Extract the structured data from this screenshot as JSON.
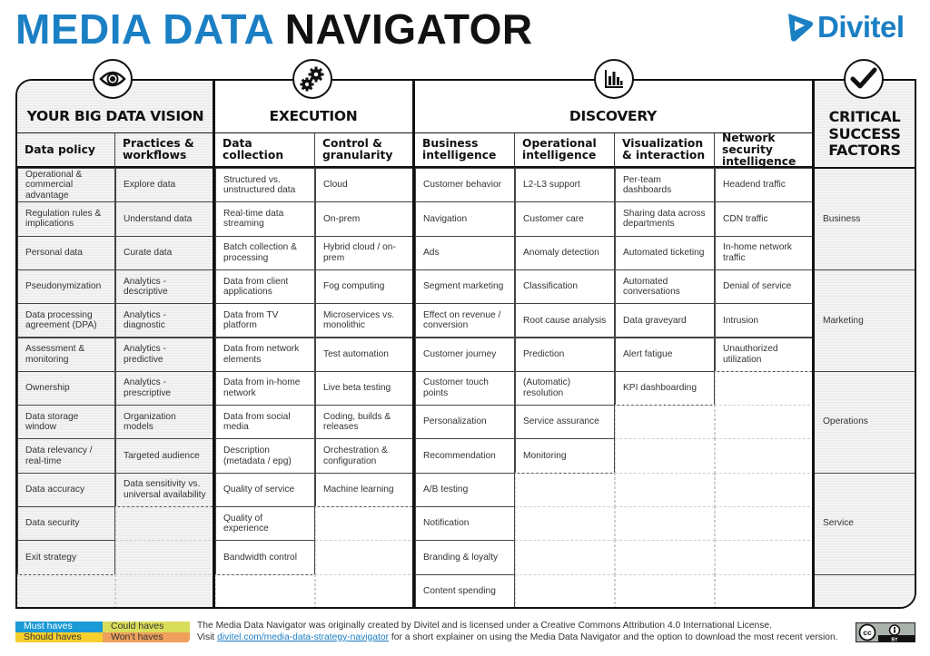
{
  "header": {
    "title_part1": "MEDIA DATA",
    "title_part2": "NAVIGATOR",
    "logo_text": "Divitel",
    "brand_color": "#1b7fc4"
  },
  "sections": [
    {
      "title": "YOUR BIG DATA VISION",
      "icon": "eye-icon"
    },
    {
      "title": "EXECUTION",
      "icon": "gears-icon"
    },
    {
      "title": "DISCOVERY",
      "icon": "bar-chart-icon"
    },
    {
      "title": "CRITICAL SUCCESS FACTORS",
      "title_lines": [
        "CRITICAL",
        "SUCCESS",
        "FACTORS"
      ],
      "icon": "checkmark-icon"
    }
  ],
  "columns": [
    {
      "header": "Data policy",
      "items": [
        "Operational & commercial advantage",
        "Regulation rules & implications",
        "Personal data",
        "Pseudonymization",
        "Data processing agreement (DPA)",
        "Assessment & monitoring",
        "Ownership",
        "Data storage window",
        "Data relevancy / real-time",
        "Data accuracy",
        "Data security",
        "Exit strategy"
      ]
    },
    {
      "header": "Practices & workflows",
      "items": [
        "Explore data",
        "Understand data",
        "Curate data",
        "Analytics - descriptive",
        "Analytics - diagnostic",
        "Analytics - predictive",
        "Analytics - prescriptive",
        "Organization models",
        "Targeted audience",
        "Data sensitivity vs. universal availability"
      ]
    },
    {
      "header": "Data collection",
      "items": [
        "Structured vs. unstructured data",
        "Real-time data streaming",
        "Batch collection & processing",
        "Data from client applications",
        "Data from TV platform",
        "Data from network elements",
        "Data from in-home network",
        "Data from social media",
        "Description (metadata / epg)",
        "Quality of service",
        "Quality of experience",
        "Bandwidth control"
      ]
    },
    {
      "header": "Control & granularity",
      "items": [
        "Cloud",
        "On-prem",
        "Hybrid cloud / on-prem",
        "Fog computing",
        "Microservices vs. monolithic",
        "Test automation",
        "Live beta testing",
        "Coding, builds & releases",
        "Orchestration & configuration",
        "Machine learning"
      ]
    },
    {
      "header": "Business intelligence",
      "items": [
        "Customer behavior",
        "Navigation",
        "Ads",
        "Segment marketing",
        "Effect on revenue / conversion",
        "Customer journey",
        "Customer touch points",
        "Personalization",
        "Recommendation",
        "A/B testing",
        "Notification",
        "Branding & loyalty",
        "Content spending"
      ]
    },
    {
      "header": "Operational intelligence",
      "items": [
        "L2-L3 support",
        "Customer care",
        "Anomaly detection",
        "Classification",
        "Root cause analysis",
        "Prediction",
        "(Automatic) resolution",
        "Service assurance",
        "Monitoring"
      ]
    },
    {
      "header": "Visualization & interaction",
      "items": [
        "Per-team dashboards",
        "Sharing data across departments",
        "Automated ticketing",
        "Automated conversations",
        "Data graveyard",
        "Alert fatigue",
        "KPI dashboarding"
      ]
    },
    {
      "header": "Network security intelligence",
      "items": [
        "Headend traffic",
        "CDN traffic",
        "In-home network traffic",
        "Denial of service",
        "Intrusion",
        "Unauthorized utilization"
      ]
    }
  ],
  "success_factors": [
    "Business",
    "Marketing",
    "Operations",
    "Service"
  ],
  "legend": [
    {
      "label": "Must haves",
      "color": "#1a9ad6",
      "text_color": "#ffffff"
    },
    {
      "label": "Could haves",
      "color": "#dadd5a",
      "text_color": "#333333"
    },
    {
      "label": "Should haves",
      "color": "#f6cf2e",
      "text_color": "#333333"
    },
    {
      "label": "Won’t haves",
      "color": "#eea05c",
      "text_color": "#333333"
    }
  ],
  "footer": {
    "line1": "The Media Data Navigator was originally created by Divitel and is licensed under a Creative Commons Attribution 4.0 International License.",
    "line2_prefix": "Visit ",
    "link_text": "divitel.com/media-data-strategy-navigator",
    "line2_suffix": " for a short explainer on using the Media Data Navigator and the option to download the most recent version.",
    "license_badge": "CC BY"
  }
}
